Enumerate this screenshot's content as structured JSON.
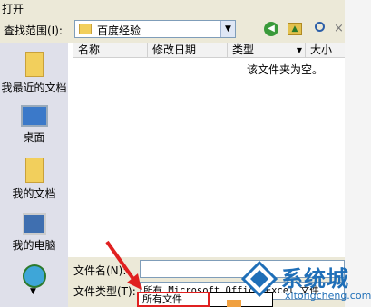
{
  "window": {
    "title": "打开"
  },
  "toolbar": {
    "look_in_label": "查找范围(I):",
    "look_in_value": "百度经验",
    "back_glyph": "◀",
    "up_glyph": "▲",
    "dropdown_arrow": "▼",
    "close_glyph": "×"
  },
  "places": [
    {
      "label": "我最近的文档",
      "icon": "recent-docs-icon"
    },
    {
      "label": "桌面",
      "icon": "desktop-icon"
    },
    {
      "label": "我的文档",
      "icon": "my-documents-icon"
    },
    {
      "label": "我的电脑",
      "icon": "my-computer-icon"
    },
    {
      "label": "",
      "icon": "network-icon"
    }
  ],
  "list": {
    "columns": [
      "名称",
      "修改日期",
      "类型",
      "大小"
    ],
    "sort_arrow": "▼",
    "empty_message": "该文件夹为空。"
  },
  "bottom": {
    "file_name_label": "文件名(N):",
    "file_name_value": "",
    "file_type_label": "文件类型(T):",
    "file_type_value": "所有 Microsoft Office Excel 文件",
    "dropdown_option": "所有文件"
  },
  "watermark": {
    "name": "系统城",
    "url": "xitongcheng.com"
  },
  "colors": {
    "highlight_red": "#e02020",
    "watermark_blue": "#1f6fb8"
  }
}
